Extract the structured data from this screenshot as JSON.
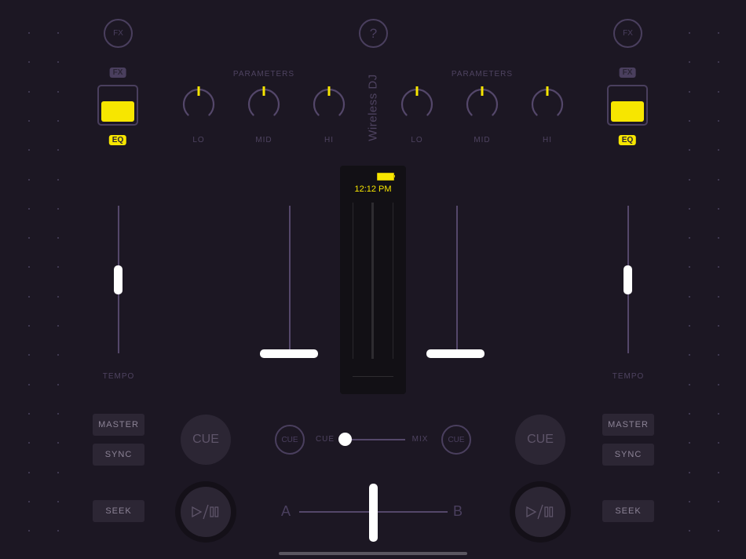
{
  "app": {
    "title": "Wireless DJ"
  },
  "colors": {
    "accent": "#f7e600",
    "background": "#1c1723",
    "track": "#54476a",
    "button": "#2c2634"
  },
  "header": {
    "help_label": "?"
  },
  "decks": [
    {
      "id": "left",
      "fx_button_label": "FX",
      "fx_tag": "FX",
      "eq_tag": "EQ",
      "mode_selected": "EQ",
      "parameters_label": "PARAMETERS",
      "knobs": [
        {
          "label": "LO",
          "value": 0.5
        },
        {
          "label": "MID",
          "value": 0.5
        },
        {
          "label": "HI",
          "value": 0.5
        }
      ],
      "tempo_label": "TEMPO",
      "tempo_value": 0.5,
      "volume_value": 0.0,
      "master_label": "MASTER",
      "sync_label": "SYNC",
      "seek_label": "SEEK",
      "cue_label": "CUE",
      "headphone_cue_label": "CUE",
      "play_pause_icon": "play-pause-icon"
    },
    {
      "id": "right",
      "fx_button_label": "FX",
      "fx_tag": "FX",
      "eq_tag": "EQ",
      "mode_selected": "EQ",
      "parameters_label": "PARAMETERS",
      "knobs": [
        {
          "label": "LO",
          "value": 0.5
        },
        {
          "label": "MID",
          "value": 0.5
        },
        {
          "label": "HI",
          "value": 0.5
        }
      ],
      "tempo_label": "TEMPO",
      "tempo_value": 0.5,
      "volume_value": 0.0,
      "master_label": "MASTER",
      "sync_label": "SYNC",
      "seek_label": "SEEK",
      "cue_label": "CUE",
      "headphone_cue_label": "CUE",
      "play_pause_icon": "play-pause-icon"
    }
  ],
  "center_display": {
    "time": "12:12 PM",
    "battery_icon": "battery-icon",
    "battery_level": 1.0
  },
  "cue_mix": {
    "left_label": "CUE",
    "right_label": "MIX",
    "value": 0.0
  },
  "crossfader": {
    "left_label": "A",
    "right_label": "B",
    "value": 0.5
  }
}
